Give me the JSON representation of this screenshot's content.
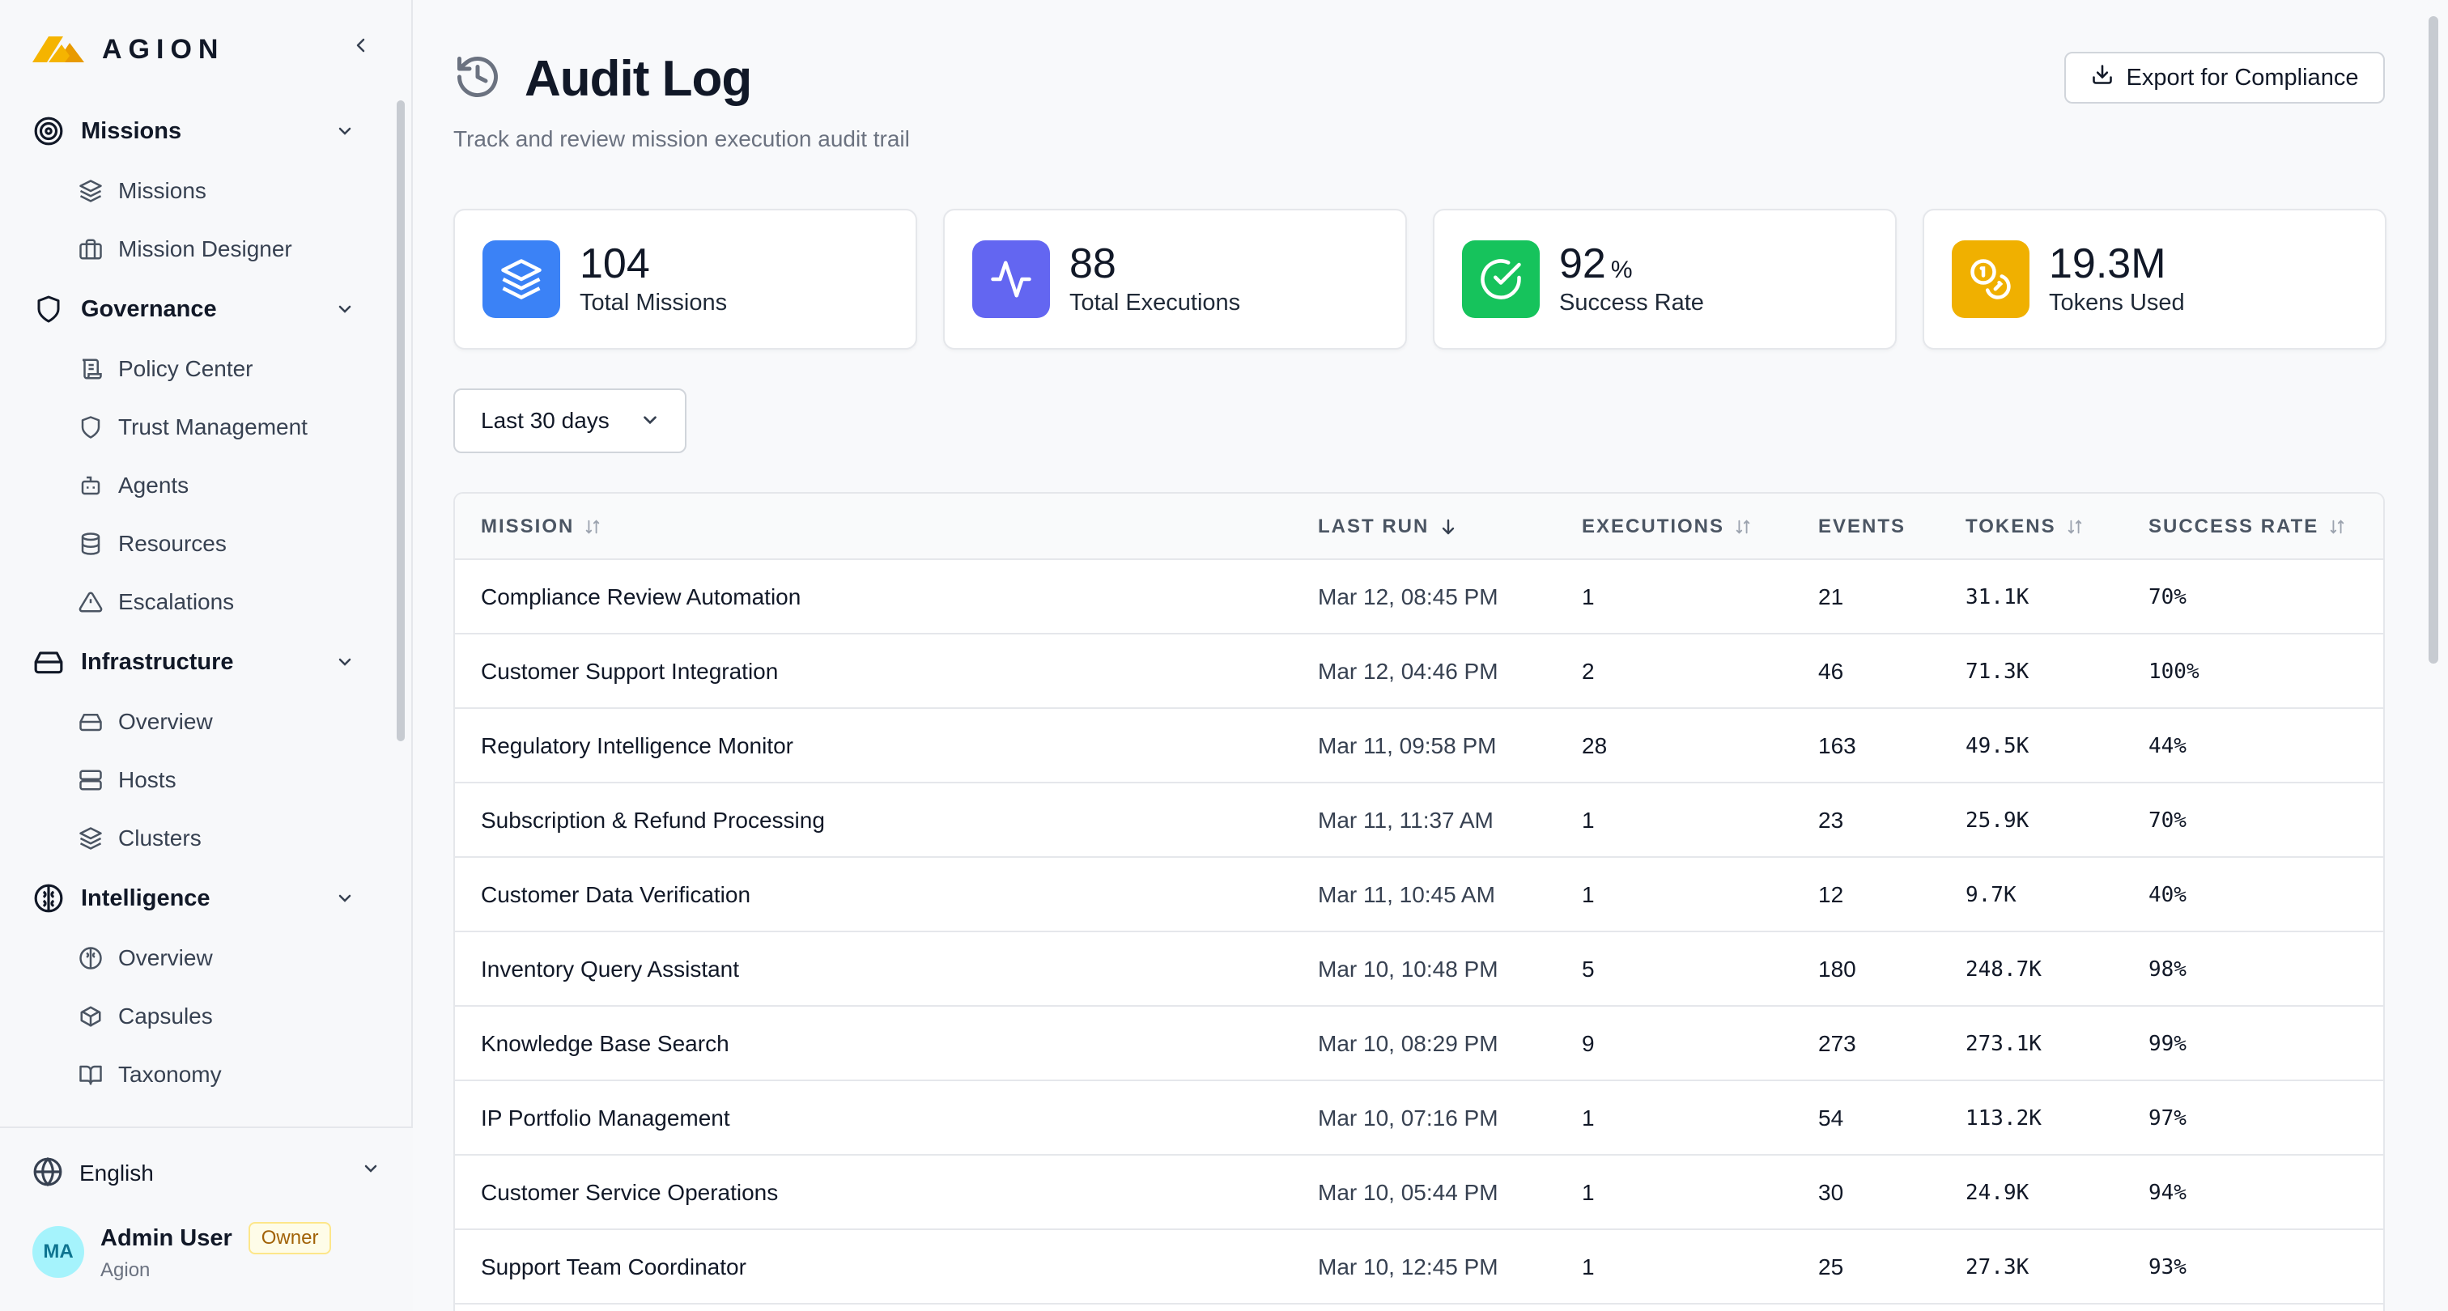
{
  "brand": {
    "name": "AGION",
    "mark_color_1": "#f5b400",
    "mark_color_2": "#e89a00"
  },
  "sidebar": {
    "groups": [
      {
        "label": "Missions",
        "icon": "target-icon",
        "items": [
          {
            "label": "Missions",
            "icon": "layers-icon"
          },
          {
            "label": "Mission Designer",
            "icon": "briefcase-icon"
          }
        ]
      },
      {
        "label": "Governance",
        "icon": "shield-icon",
        "items": [
          {
            "label": "Policy Center",
            "icon": "scroll-icon"
          },
          {
            "label": "Trust Management",
            "icon": "shield-icon"
          },
          {
            "label": "Agents",
            "icon": "bot-icon"
          },
          {
            "label": "Resources",
            "icon": "database-icon"
          },
          {
            "label": "Escalations",
            "icon": "alert-triangle-icon"
          }
        ]
      },
      {
        "label": "Infrastructure",
        "icon": "hard-drive-icon",
        "items": [
          {
            "label": "Overview",
            "icon": "hard-drive-icon"
          },
          {
            "label": "Hosts",
            "icon": "server-icon"
          },
          {
            "label": "Clusters",
            "icon": "layers-icon"
          }
        ]
      },
      {
        "label": "Intelligence",
        "icon": "brain-icon",
        "items": [
          {
            "label": "Overview",
            "icon": "brain-icon"
          },
          {
            "label": "Capsules",
            "icon": "package-icon"
          },
          {
            "label": "Taxonomy",
            "icon": "book-open-icon"
          }
        ]
      }
    ],
    "footer": {
      "language": "English",
      "user_initials": "MA",
      "user_name": "Admin User",
      "user_role": "Owner",
      "user_org": "Agion"
    }
  },
  "page": {
    "title": "Audit Log",
    "subtitle": "Track and review mission execution audit trail",
    "export_label": "Export for Compliance",
    "range_label": "Last 30 days"
  },
  "stats": [
    {
      "value": "104",
      "unit": "",
      "label": "Total Missions",
      "icon": "layers-icon",
      "color": "#3b82f6"
    },
    {
      "value": "88",
      "unit": "",
      "label": "Total Executions",
      "icon": "activity-icon",
      "color": "#6366f1"
    },
    {
      "value": "92",
      "unit": "%",
      "label": "Success Rate",
      "icon": "check-circle-icon",
      "color": "#16c35c"
    },
    {
      "value": "19.3M",
      "unit": "",
      "label": "Tokens Used",
      "icon": "coins-icon",
      "color": "#f0b000"
    }
  ],
  "table": {
    "columns": [
      "MISSION",
      "LAST RUN",
      "EXECUTIONS",
      "EVENTS",
      "TOKENS",
      "SUCCESS RATE"
    ],
    "rows": [
      [
        "Compliance Review Automation",
        "Mar 12, 08:45 PM",
        "1",
        "21",
        "31.1K",
        "70%"
      ],
      [
        "Customer Support Integration",
        "Mar 12, 04:46 PM",
        "2",
        "46",
        "71.3K",
        "100%"
      ],
      [
        "Regulatory Intelligence Monitor",
        "Mar 11, 09:58 PM",
        "28",
        "163",
        "49.5K",
        "44%"
      ],
      [
        "Subscription & Refund Processing",
        "Mar 11, 11:37 AM",
        "1",
        "23",
        "25.9K",
        "70%"
      ],
      [
        "Customer Data Verification",
        "Mar 11, 10:45 AM",
        "1",
        "12",
        "9.7K",
        "40%"
      ],
      [
        "Inventory Query Assistant",
        "Mar 10, 10:48 PM",
        "5",
        "180",
        "248.7K",
        "98%"
      ],
      [
        "Knowledge Base Search",
        "Mar 10, 08:29 PM",
        "9",
        "273",
        "273.1K",
        "99%"
      ],
      [
        "IP Portfolio Management",
        "Mar 10, 07:16 PM",
        "1",
        "54",
        "113.2K",
        "97%"
      ],
      [
        "Customer Service Operations",
        "Mar 10, 05:44 PM",
        "1",
        "30",
        "24.9K",
        "94%"
      ],
      [
        "Support Team Coordinator",
        "Mar 10, 12:45 PM",
        "1",
        "25",
        "27.3K",
        "93%"
      ]
    ]
  }
}
